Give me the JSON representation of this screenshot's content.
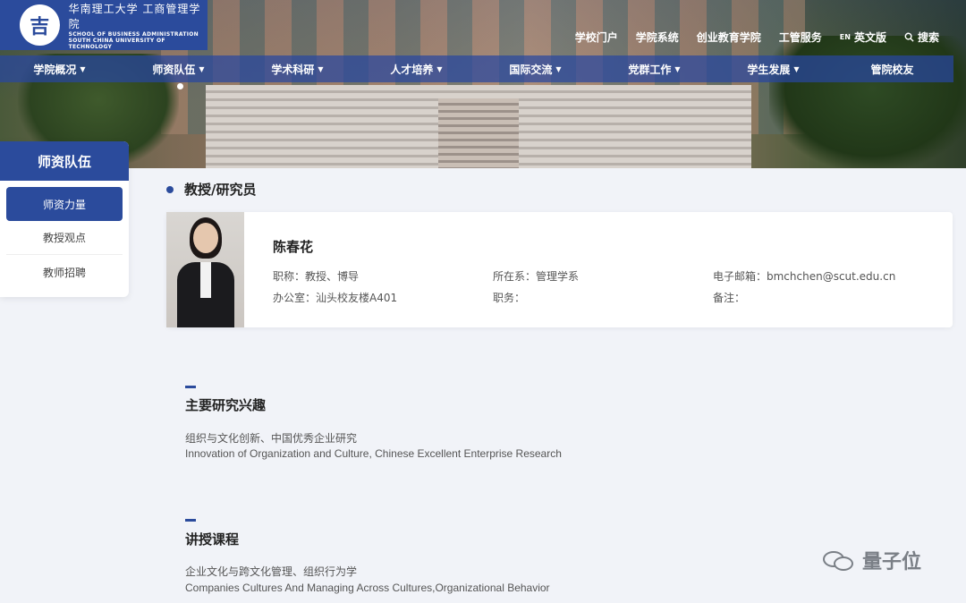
{
  "brand": {
    "emblem_glyph": "吉",
    "cn": "华南理工大学 工商管理学院",
    "en_line1": "SCHOOL OF BUSINESS ADMINISTRATION",
    "en_line2": "SOUTH CHINA UNIVERSITY OF TECHNOLOGY"
  },
  "topnav": {
    "items": [
      "学校门户",
      "学院系统",
      "创业教育学院",
      "工管服务"
    ],
    "en_badge": "EN",
    "english": "英文版",
    "search": "搜索"
  },
  "mainnav": {
    "items": [
      "学院概况",
      "师资队伍",
      "学术科研",
      "人才培养",
      "国际交流",
      "党群工作",
      "学生发展",
      "管院校友"
    ]
  },
  "sidebar": {
    "header": "师资队伍",
    "items": [
      "师资力量",
      "教授观点",
      "教师招聘"
    ]
  },
  "section": {
    "title": "教授/研究员"
  },
  "profile": {
    "name": "陈春花",
    "title": "职称：教授、博导",
    "dept": "所在系：管理学系",
    "email": "电子邮箱：bmchchen@scut.edu.cn",
    "office": "办公室：汕头校友楼A401",
    "duty": "职务：",
    "note": "备注："
  },
  "research": {
    "title": "主要研究兴趣",
    "cn": "组织与文化创新、中国优秀企业研究",
    "en": "Innovation of Organization and Culture, Chinese Excellent Enterprise  Research"
  },
  "courses": {
    "title": "讲授课程",
    "cn": "企业文化与跨文化管理、组织行为学",
    "en": "Companies Cultures And Managing Across Cultures,Organizational Behavior"
  },
  "watermark": {
    "text": "量子位"
  },
  "colors": {
    "primary": "#2b4b9c",
    "nav_overlay": "rgba(40,70,160,0.72)"
  }
}
